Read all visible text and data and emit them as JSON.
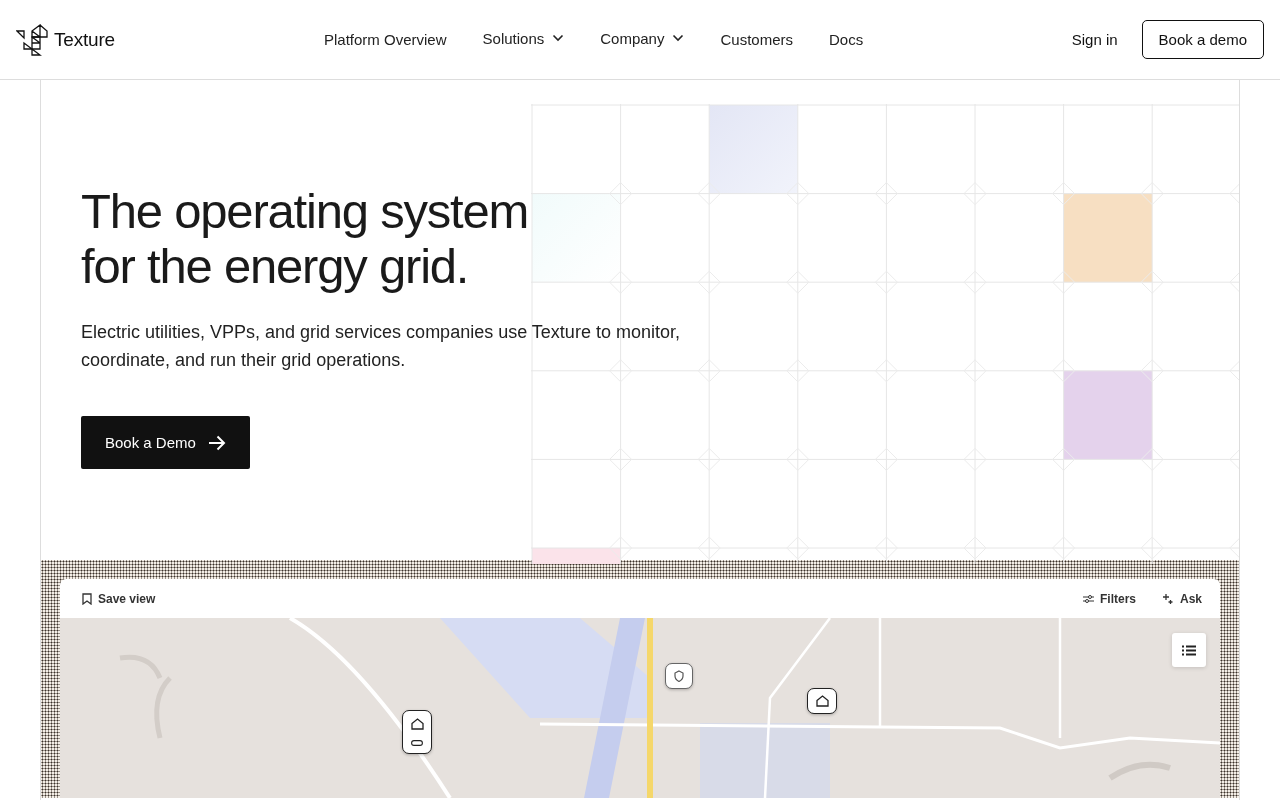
{
  "header": {
    "logo": "Texture",
    "nav": [
      {
        "label": "Platform Overview",
        "dropdown": false
      },
      {
        "label": "Solutions",
        "dropdown": true
      },
      {
        "label": "Company",
        "dropdown": true
      },
      {
        "label": "Customers",
        "dropdown": false
      },
      {
        "label": "Docs",
        "dropdown": false
      }
    ],
    "sign_in": "Sign in",
    "cta": "Book a demo"
  },
  "hero": {
    "title_lines": [
      "The operating system",
      "for the energy grid."
    ],
    "subtitle": "Electric utilities, VPPs, and grid services companies use Texture to monitor, coordinate, and run their grid operations.",
    "button": "Book a Demo"
  },
  "map_preview": {
    "save_view": "Save view",
    "filters": "Filters",
    "ask": "Ask"
  }
}
